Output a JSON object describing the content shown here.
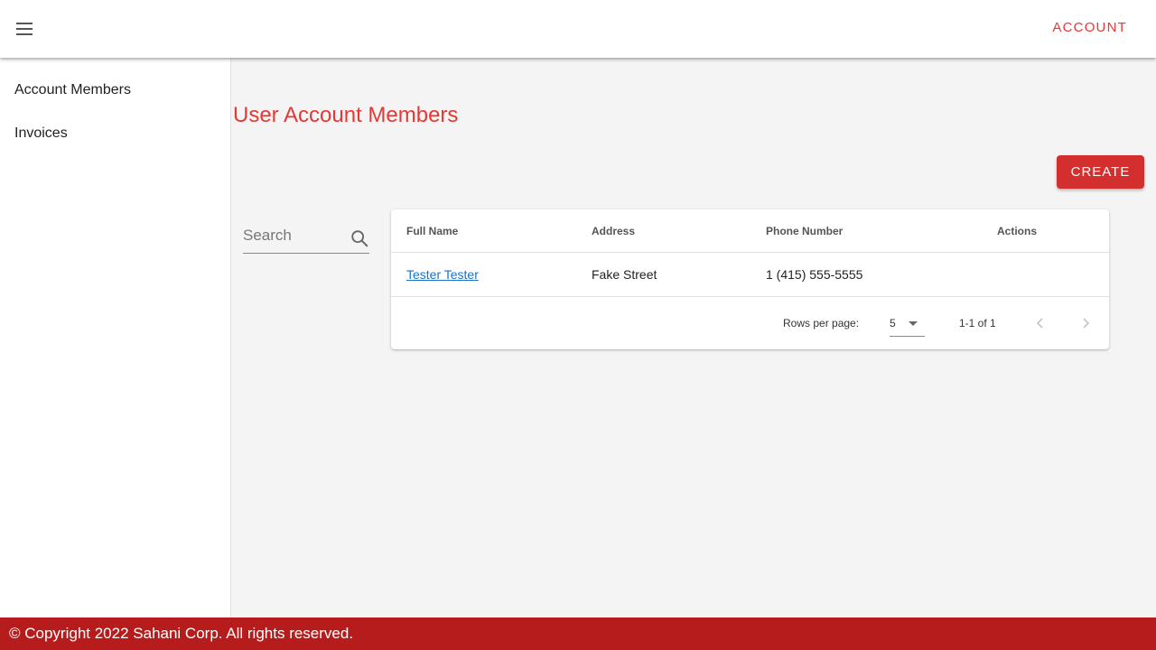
{
  "header": {
    "menu_icon": "hamburger-menu-icon",
    "account_label": "ACCOUNT",
    "accent_color": "#e53935"
  },
  "sidebar": {
    "items": [
      {
        "label": "Account Members"
      },
      {
        "label": "Invoices"
      }
    ]
  },
  "main": {
    "title": "User Account Members",
    "create_label": "CREATE",
    "create_color": "#d32f2f",
    "search": {
      "placeholder": "Search",
      "icon": "search-icon"
    }
  },
  "table": {
    "columns": [
      "Full Name",
      "Address",
      "Phone Number",
      "Actions"
    ],
    "rows": [
      {
        "full_name": "Tester Tester",
        "address": "Fake Street",
        "phone": "1 (415) 555-5555",
        "actions": ""
      }
    ],
    "pagination": {
      "rows_per_page_label": "Rows per page:",
      "rows_per_page": "5",
      "range": "1-1 of 1",
      "prev_icon": "chevron-left-icon",
      "next_icon": "chevron-right-icon"
    }
  },
  "footer": {
    "text": "© Copyright 2022 Sahani Corp. All rights reserved.",
    "color": "#b71c1c"
  }
}
